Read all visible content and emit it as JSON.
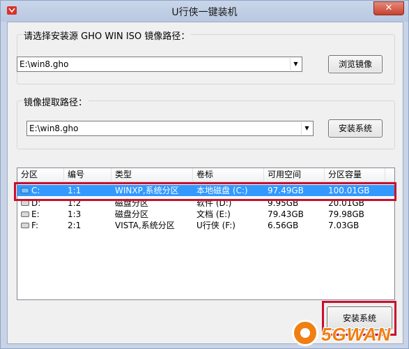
{
  "window": {
    "title": "U行侠一键装机",
    "close_symbol": "✕"
  },
  "source": {
    "group_label": "请选择安装源 GHO WIN ISO 镜像路径：",
    "path_value": "E:\\win8.gho",
    "button_label": "浏览镜像"
  },
  "extract": {
    "group_label": "镜像提取路径：",
    "path_value": "E:\\win8.gho",
    "button_label": "安装系统"
  },
  "partitions": {
    "columns": [
      "分区",
      "编号",
      "类型",
      "卷标",
      "可用空间",
      "分区容量"
    ],
    "rows": [
      {
        "drive": "C:",
        "number": "1:1",
        "type": "WINXP,系统分区",
        "label": "本地磁盘 (C:)",
        "free": "97.49GB",
        "capacity": "100.01GB"
      },
      {
        "drive": "D:",
        "number": "1:2",
        "type": "磁盘分区",
        "label": "软件 (D:)",
        "free": "9.95GB",
        "capacity": "20.01GB"
      },
      {
        "drive": "E:",
        "number": "1:3",
        "type": "磁盘分区",
        "label": "文档 (E:)",
        "free": "79.43GB",
        "capacity": "79.98GB"
      },
      {
        "drive": "F:",
        "number": "2:1",
        "type": "VISTA,系统分区",
        "label": "U行侠 (F:)",
        "free": "6.56GB",
        "capacity": "7.03GB"
      }
    ]
  },
  "footer": {
    "install_button_label": "安装系统"
  },
  "watermark": {
    "text": "5GWAN"
  },
  "colors": {
    "highlight": "#c8102e",
    "selection": "#3399ff",
    "watermark": "#f07f12"
  }
}
